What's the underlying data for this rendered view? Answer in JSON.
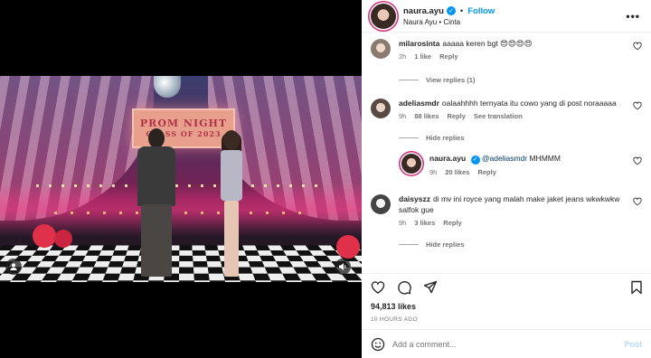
{
  "colors": {
    "accent": "#0095f6",
    "story_ring": "#d62976",
    "muted": "#737373",
    "post_disabled": "#b3dbff"
  },
  "media": {
    "sign_line1": "PROM NIGHT",
    "sign_line2": "CLASS OF 2023",
    "controls": {
      "left_icon": "user-tag-icon",
      "right_icon": "volume-icon"
    }
  },
  "header": {
    "username": "naura.ayu",
    "verified": true,
    "follow_label": "Follow",
    "dot": "•",
    "subtitle": "Naura Ayu • Cinta",
    "more_icon": "more-options-icon"
  },
  "comments": [
    {
      "username": "milarosinta",
      "text": "aaaaa keren bgt 😍😍😍😍",
      "time": "2h",
      "likes": "1 like",
      "reply_label": "Reply",
      "view_replies": "View replies (1)"
    },
    {
      "username": "adeliasmdr",
      "text": "oalaahhhh ternyata itu cowo yang di post noraaaaa",
      "time": "9h",
      "likes": "88 likes",
      "reply_label": "Reply",
      "translation_label": "See translation",
      "hide_replies": "Hide replies",
      "reply": {
        "username": "naura.ayu",
        "mention": "@adeliasmdr",
        "text": " MHMMM",
        "time": "9h",
        "likes": "20 likes",
        "reply_label": "Reply"
      }
    },
    {
      "username": "daisyszz",
      "text": "di mv ini royce yang malah make jaket jeans wkwkwkw salfok gue",
      "time": "9h",
      "likes": "3 likes",
      "reply_label": "Reply",
      "hide_replies": "Hide replies"
    }
  ],
  "actions": {
    "icons": [
      "heart-icon",
      "comment-icon",
      "share-icon",
      "bookmark-icon"
    ]
  },
  "likes_count": "94,813 likes",
  "timestamp": "10 HOURS AGO",
  "add_comment": {
    "placeholder": "Add a comment...",
    "post_label": "Post"
  }
}
